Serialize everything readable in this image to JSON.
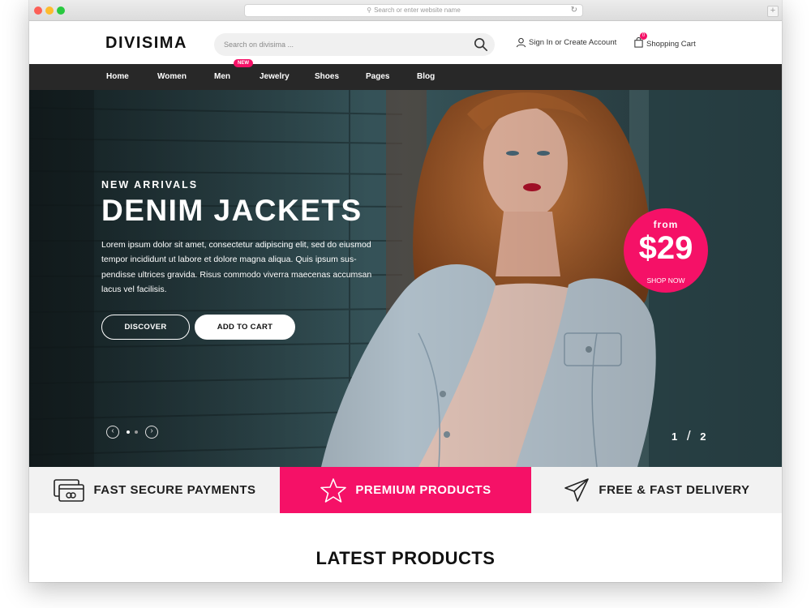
{
  "browser": {
    "url_placeholder": "Search or enter website name",
    "new_tab": "+"
  },
  "header": {
    "logo": "DIVISIMA",
    "search_placeholder": "Search on divisima ...",
    "account_label": "Sign In or Create Account",
    "cart_label": "Shopping Cart",
    "cart_count": "0"
  },
  "nav": {
    "items": [
      "Home",
      "Women",
      "Men",
      "Jewelry",
      "Shoes",
      "Pages",
      "Blog"
    ],
    "new_badge": "NEW"
  },
  "hero": {
    "eyebrow": "NEW ARRIVALS",
    "title": "DENIM JACKETS",
    "text": "Lorem ipsum dolor sit amet, consectetur adipiscing elit, sed do eiusmod tempor incididunt ut labore et dolore magna aliqua. Quis ipsum sus-pendisse ultrices gravida. Risus commodo viverra maecenas accumsan lacus vel facilisis.",
    "discover_label": "DISCOVER",
    "add_to_cart_label": "ADD TO CART",
    "price_from": "from",
    "price_value": "$29",
    "price_cta": "SHOP NOW",
    "slide_current": "1",
    "slide_separator": "/",
    "slide_total": "2"
  },
  "features": [
    {
      "label": "FAST SECURE PAYMENTS",
      "icon": "credit-card-icon"
    },
    {
      "label": "PREMIUM PRODUCTS",
      "icon": "star-icon"
    },
    {
      "label": "FREE & FAST DELIVERY",
      "icon": "paper-plane-icon"
    }
  ],
  "section": {
    "latest_title": "LATEST PRODUCTS"
  },
  "colors": {
    "accent": "#f51167",
    "nav_bg": "#282828",
    "feature_bg": "#f2f2f2"
  }
}
